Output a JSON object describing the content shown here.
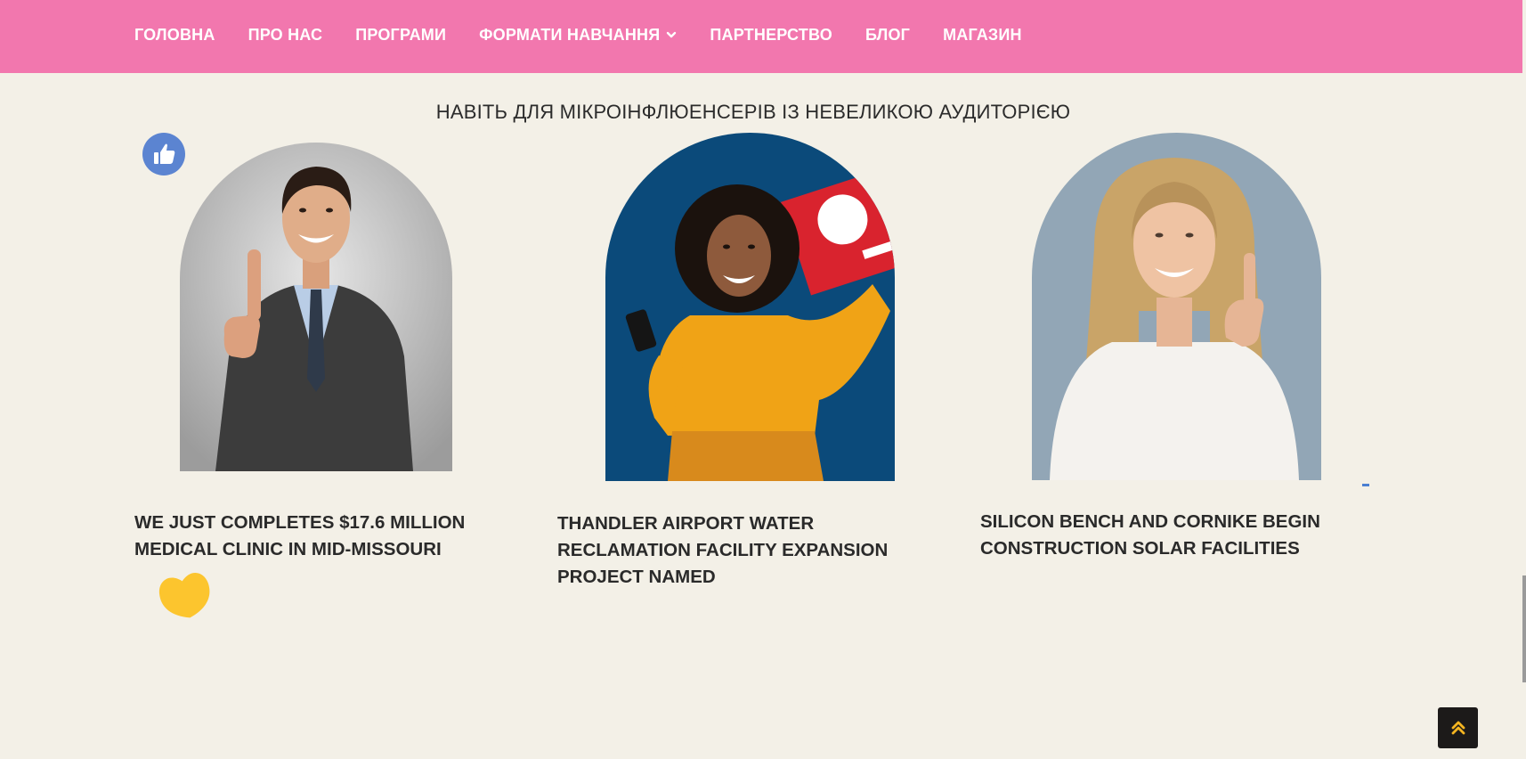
{
  "nav": {
    "items": [
      {
        "label": "ГОЛОВНА"
      },
      {
        "label": "ПРО НАС"
      },
      {
        "label": "ПРОГРАМИ"
      },
      {
        "label": "ФОРМАТИ НАВЧАННЯ",
        "has_dropdown": true
      },
      {
        "label": "ПАРТНЕРСТВО"
      },
      {
        "label": "БЛОГ"
      },
      {
        "label": "МАГАЗИН"
      }
    ]
  },
  "section": {
    "subtitle": "НАВІТЬ ДЛЯ МІКРОІНФЛЮЕНСЕРІВ ІЗ НЕВЕЛИКОЮ АУДИТОРІЄЮ"
  },
  "cards": [
    {
      "title": "WE JUST COMPLETES $17.6 MILLION MEDICAL CLINIC IN MID-MISSOURI",
      "photo": "man-in-suit-thumbs-up"
    },
    {
      "title": "THANDLER AIRPORT WATER RECLAMATION FACILITY EXPANSION PROJECT NAMED",
      "photo": "woman-yellow-sweater-phone"
    },
    {
      "title": "SILICON BENCH AND CORNIKE BEGIN CONSTRUCTION SOLAR FACILITIES",
      "photo": "woman-white-shirt-thumbs-up"
    }
  ],
  "decorations": {
    "like_icon": "thumbs-up-icon",
    "heart_icon": "heart-icon"
  },
  "scroll_top": {
    "icon": "double-chevron-up-icon"
  },
  "colors": {
    "nav_bg": "#f277ae",
    "page_bg": "#f3f0e7",
    "text_dark": "#2a2a2a",
    "like_blue": "#5b84d1",
    "heart_yellow": "#fcc52e",
    "scroll_btn_bg": "#1c1a19",
    "scroll_btn_icon": "#f5b521"
  }
}
